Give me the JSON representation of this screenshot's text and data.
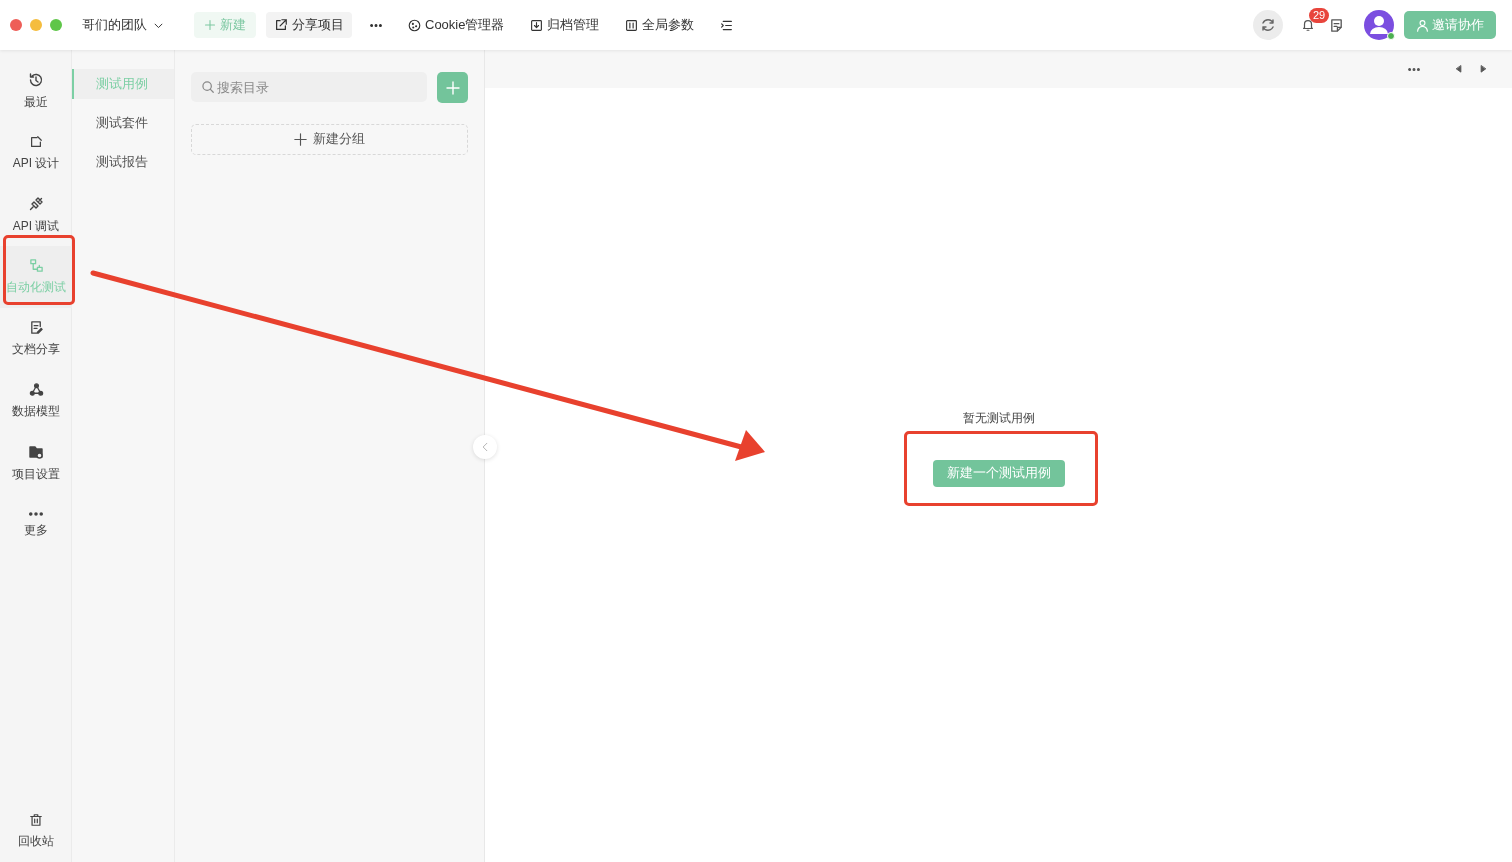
{
  "team": {
    "name": "哥们的团队"
  },
  "toolbar": [
    {
      "kind": "new",
      "label": "新建"
    },
    {
      "kind": "share",
      "label": "分享项目"
    },
    {
      "kind": "more"
    },
    {
      "kind": "cookie",
      "label": "Cookie管理器"
    },
    {
      "kind": "archive",
      "label": "归档管理"
    },
    {
      "kind": "params",
      "label": "全局参数"
    },
    {
      "kind": "menu"
    }
  ],
  "notifications": {
    "count": "29"
  },
  "invite_button": {
    "label": "邀请协作"
  },
  "nav": [
    {
      "label": "最近",
      "selected": false
    },
    {
      "label": "API 设计",
      "selected": false
    },
    {
      "label": "API 调试",
      "selected": false
    },
    {
      "label": "自动化测试",
      "selected": true
    },
    {
      "label": "文档分享",
      "selected": false
    },
    {
      "label": "数据模型",
      "selected": false
    },
    {
      "label": "项目设置",
      "selected": false
    },
    {
      "label": "更多",
      "selected": false
    }
  ],
  "nav_bottom": {
    "label": "回收站"
  },
  "subnav": [
    {
      "label": "测试用例",
      "selected": true
    },
    {
      "label": "测试套件",
      "selected": false
    },
    {
      "label": "测试报告",
      "selected": false
    }
  ],
  "tree": {
    "search": {
      "placeholder": "搜索目录"
    },
    "new_group": "新建分组"
  },
  "empty_state": {
    "message": "暂无测试用例",
    "button": "新建一个测试用例"
  }
}
